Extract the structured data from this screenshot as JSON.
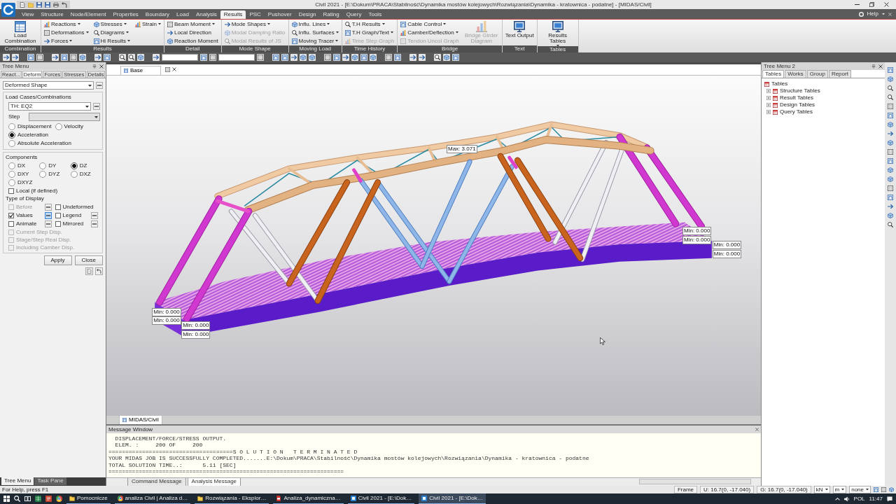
{
  "window": {
    "title": "Civil 2021 - [E:\\Dokum\\PRACA\\Stabilność\\Dynamika mostów kolejowych\\Rozwiązania\\Dynamika - kratownica - podatne] - [MIDAS/Civil]",
    "help": "Help"
  },
  "ribbon": {
    "tabs": [
      {
        "label": "View",
        "selected": false
      },
      {
        "label": "Structure",
        "selected": false
      },
      {
        "label": "Node/Element",
        "selected": false
      },
      {
        "label": "Properties",
        "selected": false
      },
      {
        "label": "Boundary",
        "selected": false
      },
      {
        "label": "Load",
        "selected": false
      },
      {
        "label": "Analysis",
        "selected": false
      },
      {
        "label": "Results",
        "selected": true
      },
      {
        "label": "PSC",
        "selected": false
      },
      {
        "label": "Pushover",
        "selected": false
      },
      {
        "label": "Design",
        "selected": false
      },
      {
        "label": "Rating",
        "selected": false
      },
      {
        "label": "Query",
        "selected": false
      },
      {
        "label": "Tools",
        "selected": false
      }
    ],
    "groups": [
      {
        "label": "Combination",
        "items": [
          {
            "label": "Load Combination",
            "kind": "large",
            "dropdown": false,
            "disabled": false
          }
        ]
      },
      {
        "label": "Results",
        "items": [
          {
            "label": "Reactions",
            "kind": "small",
            "dropdown": true,
            "disabled": false
          },
          {
            "label": "Deformations",
            "kind": "small",
            "dropdown": true,
            "disabled": false
          },
          {
            "label": "Forces",
            "kind": "small",
            "dropdown": true,
            "disabled": false
          },
          {
            "label": "Stresses",
            "kind": "small",
            "dropdown": true,
            "disabled": false
          },
          {
            "label": "Diagrams",
            "kind": "small",
            "dropdown": true,
            "disabled": false
          },
          {
            "label": "Hi Results",
            "kind": "small",
            "dropdown": true,
            "disabled": false
          },
          {
            "label": "Strain",
            "kind": "small",
            "dropdown": true,
            "disabled": false
          }
        ]
      },
      {
        "label": "Detail",
        "items": [
          {
            "label": "Beam Moment",
            "kind": "small",
            "dropdown": true,
            "disabled": false
          },
          {
            "label": "Local Direction",
            "kind": "small",
            "dropdown": false,
            "disabled": false
          },
          {
            "label": "Reaction Moment",
            "kind": "small",
            "dropdown": false,
            "disabled": false
          }
        ]
      },
      {
        "label": "Mode Shape",
        "items": [
          {
            "label": "Mode Shapes",
            "kind": "small",
            "dropdown": true,
            "disabled": false
          },
          {
            "label": "Modal Damping Ratio",
            "kind": "small",
            "dropdown": false,
            "disabled": true
          },
          {
            "label": "Modal Results of JS",
            "kind": "small",
            "dropdown": false,
            "disabled": true
          }
        ]
      },
      {
        "label": "Moving Load",
        "items": [
          {
            "label": "Influ. Lines",
            "kind": "small",
            "dropdown": true,
            "disabled": false
          },
          {
            "label": "Influ. Surfaces",
            "kind": "small",
            "dropdown": true,
            "disabled": false
          },
          {
            "label": "Moving Tracer",
            "kind": "small",
            "dropdown": true,
            "disabled": false
          }
        ]
      },
      {
        "label": "Time History",
        "items": [
          {
            "label": "T.H Results",
            "kind": "small",
            "dropdown": true,
            "disabled": false
          },
          {
            "label": "T.H Graph/Text",
            "kind": "small",
            "dropdown": true,
            "disabled": false
          },
          {
            "label": "Time Step Graph",
            "kind": "small",
            "dropdown": false,
            "disabled": true
          }
        ]
      },
      {
        "label": "Bridge",
        "items": [
          {
            "label": "Cable Control",
            "kind": "small",
            "dropdown": true,
            "disabled": false
          },
          {
            "label": "Camber/Deflection",
            "kind": "small",
            "dropdown": true,
            "disabled": false
          },
          {
            "label": "Tendon Uncol Graph",
            "kind": "small",
            "dropdown": false,
            "disabled": true
          },
          {
            "label": "Bridge Girder Diagram",
            "kind": "large",
            "dropdown": false,
            "disabled": true
          }
        ]
      },
      {
        "label": "Text",
        "items": [
          {
            "label": "Text Output",
            "kind": "large",
            "dropdown": false,
            "disabled": false
          }
        ]
      },
      {
        "label": "Tables",
        "items": [
          {
            "label": "Results Tables",
            "kind": "large",
            "dropdown": true,
            "disabled": false
          }
        ]
      }
    ]
  },
  "left_panel": {
    "title": "Tree Menu",
    "tabs": [
      {
        "label": "React...",
        "selected": false
      },
      {
        "label": "Deform",
        "selected": true
      },
      {
        "label": "Forces",
        "selected": false
      },
      {
        "label": "Stresses",
        "selected": false
      },
      {
        "label": "Details",
        "selected": false
      }
    ],
    "view_select": {
      "value": "Deformed Shape"
    },
    "load_cases_label": "Load Cases/Combinations",
    "load_case": {
      "value": "TH: EQ2"
    },
    "step_label": "Step",
    "result_types": [
      {
        "label": "Displacement",
        "selected": false
      },
      {
        "label": "Velocity",
        "selected": false
      },
      {
        "label": "Acceleration",
        "selected": true
      },
      {
        "label": "Absolute Acceleration",
        "selected": false
      }
    ],
    "components_label": "Components",
    "components": [
      {
        "label": "DX",
        "selected": false
      },
      {
        "label": "DY",
        "selected": false
      },
      {
        "label": "DZ",
        "selected": true
      },
      {
        "label": "DXY",
        "selected": false
      },
      {
        "label": "DYZ",
        "selected": false
      },
      {
        "label": "DXZ",
        "selected": false
      },
      {
        "label": "DXYZ",
        "selected": false
      }
    ],
    "local": {
      "label": "Local (if defined)",
      "checked": false
    },
    "display_label": "Type of Display",
    "display_options": [
      {
        "label": "Before",
        "checked": false,
        "disabled": true,
        "options": true
      },
      {
        "label": "Undeformed",
        "checked": false,
        "disabled": false,
        "options": false
      },
      {
        "label": "Values",
        "checked": true,
        "disabled": false,
        "options": true
      },
      {
        "label": "Legend",
        "checked": false,
        "disabled": false,
        "options": true
      },
      {
        "label": "Animate",
        "checked": false,
        "disabled": false,
        "options": true
      },
      {
        "label": "Mirrored",
        "checked": false,
        "disabled": false,
        "options": true
      }
    ],
    "stage_options": [
      {
        "label": "Current Step Disp.",
        "checked": false,
        "disabled": true
      },
      {
        "label": "Stage/Step Real Disp.",
        "checked": false,
        "disabled": true
      },
      {
        "label": "Including Camber Disp.",
        "checked": false,
        "disabled": true
      }
    ],
    "buttons": [
      "Apply",
      "Close"
    ],
    "bottom_tabs": [
      {
        "label": "Tree Menu",
        "selected": true
      },
      {
        "label": "Task Pane",
        "selected": false
      }
    ]
  },
  "viewport": {
    "tab": "Base",
    "labels": [
      {
        "text": "Max: 3.071"
      },
      {
        "text": "Min: 0.000"
      },
      {
        "text": "Min: 0.000"
      },
      {
        "text": "Min: 0.000"
      },
      {
        "text": "Min: 0.000"
      },
      {
        "text": "Min: 0.000"
      },
      {
        "text": "Min: 0.000"
      },
      {
        "text": "Min: 0.000"
      },
      {
        "text": "Min: 0.000"
      }
    ],
    "bottom_tab": "MIDAS/Civil"
  },
  "message_window": {
    "title": "Message Window",
    "lines": [
      "  DISPLACEMENT/FORCE/STRESS OUTPUT.",
      "  ELEM. :     200 OF     200",
      "=====================================S O L U T I O N   T E R M I N A T E D",
      "YOUR MIDAS JOB IS SUCCESSFULLY COMPLETED.......E:\\Dokum\\PRACA\\Stabilność\\Dynamika mostów kolejowych\\Rozwiązania\\Dynamika - kratownica - podatne",
      "TOTAL SOLUTION TIME..:      5.11 [SEC]",
      "======================================================================"
    ],
    "tabs": [
      {
        "label": "Command Message",
        "selected": false
      },
      {
        "label": "Analysis Message",
        "selected": true
      }
    ]
  },
  "right_panel": {
    "title": "Tree Menu 2",
    "tabs": [
      {
        "label": "Tables",
        "selected": true
      },
      {
        "label": "Works",
        "selected": false
      },
      {
        "label": "Group",
        "selected": false
      },
      {
        "label": "Report",
        "selected": false
      }
    ],
    "tree": [
      {
        "label": "Tables",
        "children": [
          {
            "label": "Structure Tables",
            "expanded": false
          },
          {
            "label": "Result Tables",
            "expanded": false
          },
          {
            "label": "Design Tables",
            "expanded": false
          },
          {
            "label": "Query Tables",
            "expanded": false
          }
        ]
      }
    ]
  },
  "status_bar": {
    "help": "For Help, press F1",
    "cells": [
      "Frame",
      "U: 16.7(0, -17.040)",
      "G: 16.7(0, -17.040)"
    ],
    "units": [
      "kN",
      "m",
      "none"
    ]
  },
  "taskbar": {
    "apps": [
      {
        "label": "Pomocnicze",
        "active": false
      },
      {
        "label": "analiza Civil | Analiza d…",
        "active": false
      },
      {
        "label": "Rozwiązania - Eksplor…",
        "active": false
      },
      {
        "label": "Analiza_dynamiczna…",
        "active": false
      },
      {
        "label": "Civil 2021 - [E:\\Dok…",
        "active": false
      },
      {
        "label": "Civil 2021 - [E:\\Dok…",
        "active": true
      }
    ],
    "language": "POL",
    "clock": "11:47"
  }
}
